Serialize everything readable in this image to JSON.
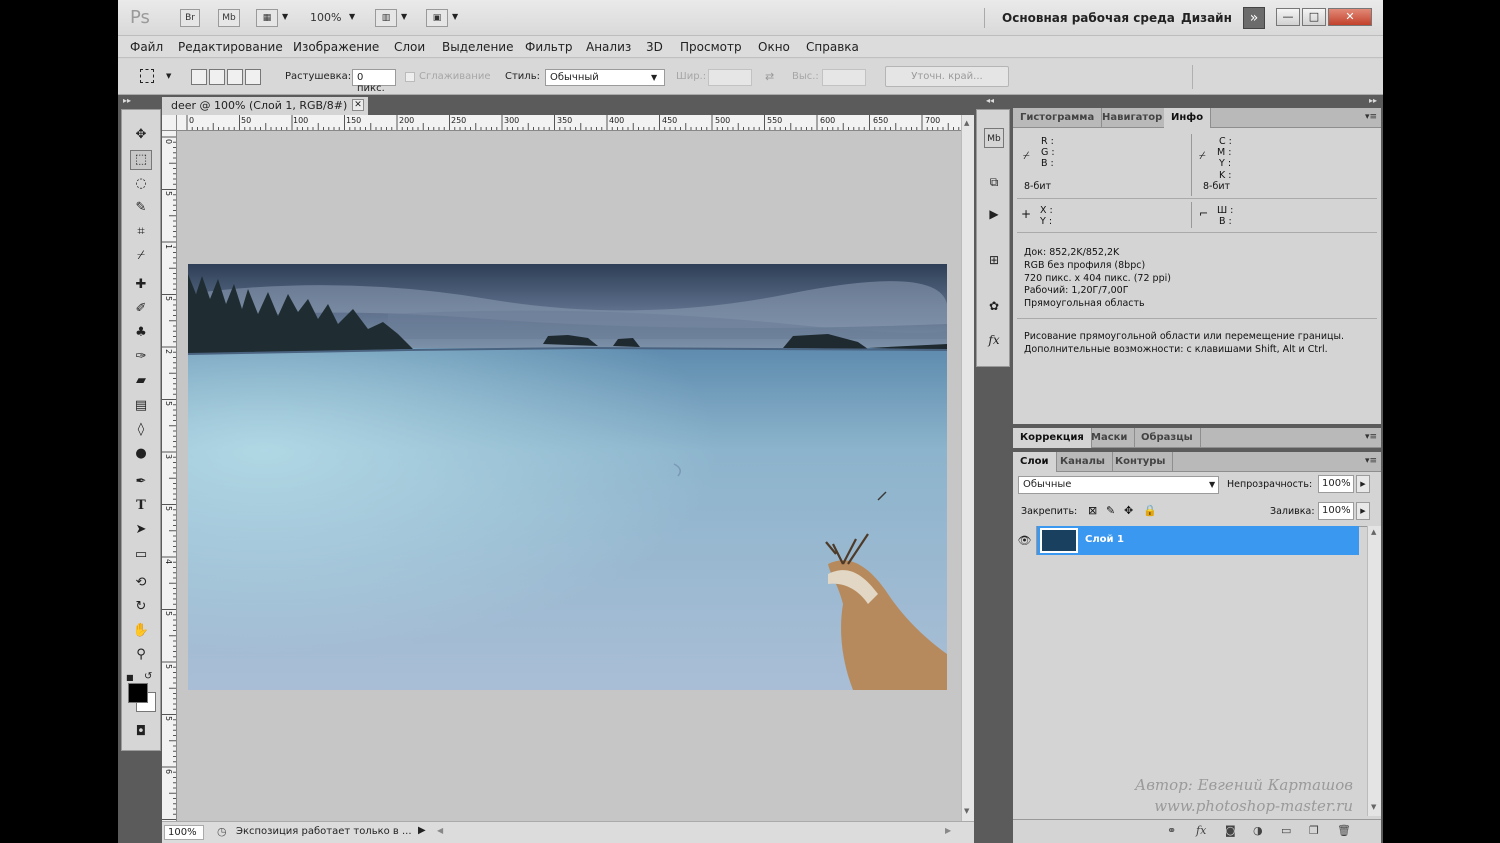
{
  "titlebar": {
    "ps_label": "Ps",
    "br_label": "Br",
    "mb_label": "Mb",
    "zoom": "100%",
    "workspace": "Основная рабочая среда",
    "design": "Дизайн"
  },
  "menu": [
    "Файл",
    "Редактирование",
    "Изображение",
    "Слои",
    "Выделение",
    "Фильтр",
    "Анализ",
    "3D",
    "Просмотр",
    "Окно",
    "Справка"
  ],
  "options": {
    "feather_label": "Растушевка:",
    "feather_value": "0 пикс.",
    "antialias_label": "Сглаживание",
    "style_label": "Стиль:",
    "style_value": "Обычный",
    "width_label": "Шир.:",
    "height_label": "Выс.:",
    "refine_edge": "Уточн. край..."
  },
  "document": {
    "tab_title": "deer @ 100% (Слой 1, RGB/8#)",
    "ruler_marks": [
      "0",
      "50",
      "100",
      "150",
      "200",
      "250",
      "300",
      "350",
      "400",
      "450",
      "500",
      "550",
      "600",
      "650",
      "700"
    ],
    "ruler_marks_v": [
      "0",
      "5",
      "1",
      "5",
      "2",
      "5",
      "3",
      "5",
      "4",
      "5",
      "5",
      "5",
      "6"
    ],
    "zoom": "100%",
    "status": "Экспозиция работает только в ..."
  },
  "info_panel": {
    "tabs": [
      "Гистограмма",
      "Навигатор",
      "Инфо"
    ],
    "rgb": [
      "R :",
      "G :",
      "B :"
    ],
    "cmyk": [
      "C :",
      "M :",
      "Y :",
      "K :"
    ],
    "bits_left": "8-бит",
    "bits_right": "8-бит",
    "xy": [
      "X :",
      "Y :"
    ],
    "wh": [
      "Ш :",
      "В :"
    ],
    "doc_info": [
      "Док: 852,2K/852,2K",
      "RGB без профиля (8bpc)",
      "720 пикс. x 404 пикс. (72 ppi)",
      "Рабочий: 1,20Г/7,00Г",
      "Прямоугольная область"
    ],
    "hint": [
      "Рисование прямоугольной области или перемещение границы.",
      "Дополнительные возможности: с клавишами Shift, Alt и Ctrl."
    ]
  },
  "adjust_panel": {
    "tabs": [
      "Коррекция",
      "Маски",
      "Образцы"
    ]
  },
  "layers_panel": {
    "tabs": [
      "Слои",
      "Каналы",
      "Контуры"
    ],
    "blend_mode": "Обычные",
    "opacity_label": "Непрозрачность:",
    "opacity_value": "100%",
    "lock_label": "Закрепить:",
    "fill_label": "Заливка:",
    "fill_value": "100%",
    "layer_name": "Слой 1"
  },
  "watermark": {
    "line1": "Автор: Евгений Карташов",
    "line2": "www.photoshop-master.ru"
  },
  "colors": {
    "selection": "#3b98f0",
    "panel_bg": "#d4d4d4",
    "dark_bg": "#5b5b5b"
  }
}
